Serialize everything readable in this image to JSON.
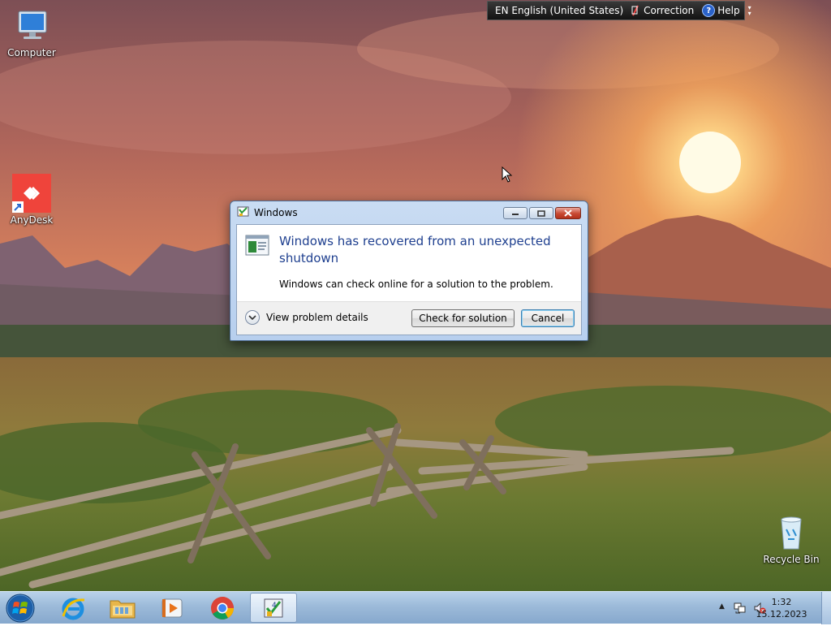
{
  "desktop": {
    "icons": [
      {
        "label": "Computer",
        "icon": "computer-icon"
      },
      {
        "label": "AnyDesk",
        "icon": "anydesk-icon"
      },
      {
        "label": "Recycle Bin",
        "icon": "recycle-bin-icon"
      }
    ]
  },
  "language_bar": {
    "language": "EN English (United States)",
    "correction": "Correction",
    "help": "Help"
  },
  "dialog": {
    "title": "Windows",
    "heading": "Windows has recovered from an unexpected shutdown",
    "description": "Windows can check online for a solution to the problem.",
    "details_label": "View problem details",
    "check_button": "Check for solution",
    "cancel_button": "Cancel"
  },
  "taskbar": {
    "apps": [
      {
        "name": "Internet Explorer",
        "icon": "internet-explorer-icon"
      },
      {
        "name": "Windows Explorer",
        "icon": "folder-icon"
      },
      {
        "name": "Windows Media Player",
        "icon": "media-player-icon"
      },
      {
        "name": "Google Chrome",
        "icon": "chrome-icon"
      },
      {
        "name": "Problem Reports",
        "icon": "problem-reports-icon"
      }
    ],
    "clock": {
      "time": "1:32",
      "date": "15.12.2023"
    }
  },
  "colors": {
    "dialog_heading": "#1e3f8f",
    "taskbar": "#9cbad9",
    "close_button": "#c84a33",
    "anydesk": "#ef443b"
  }
}
